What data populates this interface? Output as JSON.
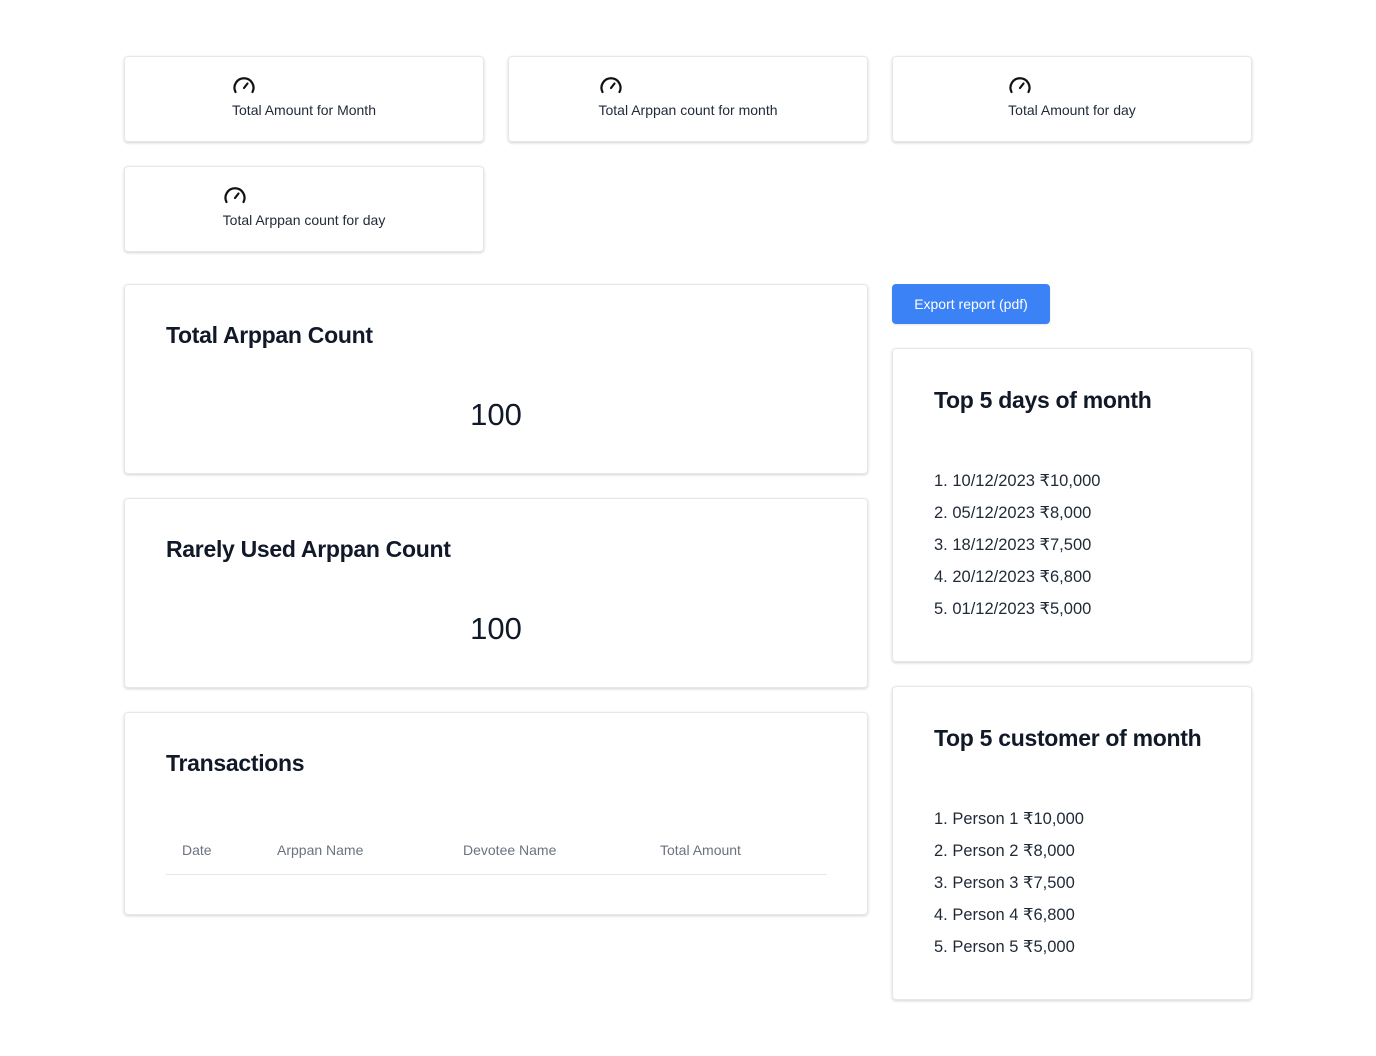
{
  "stats": [
    {
      "label": "Total Amount for Month",
      "icon": "speedometer-icon"
    },
    {
      "label": "Total Arppan count for month",
      "icon": "speedometer-icon"
    },
    {
      "label": "Total Amount for day",
      "icon": "speedometer-icon"
    },
    {
      "label": "Total Arppan count for day",
      "icon": "speedometer-icon"
    }
  ],
  "total_arppan": {
    "title": "Total Arppan Count",
    "value": "100"
  },
  "rarely_used": {
    "title": "Rarely Used Arppan Count",
    "value": "100"
  },
  "transactions": {
    "title": "Transactions",
    "columns": [
      "Date",
      "Arppan Name",
      "Devotee Name",
      "Total Amount"
    ]
  },
  "export_button": {
    "label": "Export report (pdf)",
    "color": "#3b82f6"
  },
  "top_days": {
    "title": "Top 5 days of month",
    "items": [
      "1. 10/12/2023 ₹10,000",
      "2. 05/12/2023 ₹8,000",
      "3. 18/12/2023 ₹7,500",
      "4. 20/12/2023 ₹6,800",
      "5. 01/12/2023 ₹5,000"
    ]
  },
  "top_customers": {
    "title": "Top 5 customer of month",
    "items": [
      "1. Person 1 ₹10,000",
      "2. Person 2 ₹8,000",
      "3. Person 3 ₹7,500",
      "4. Person 4 ₹6,800",
      "5. Person 5 ₹5,000"
    ]
  }
}
